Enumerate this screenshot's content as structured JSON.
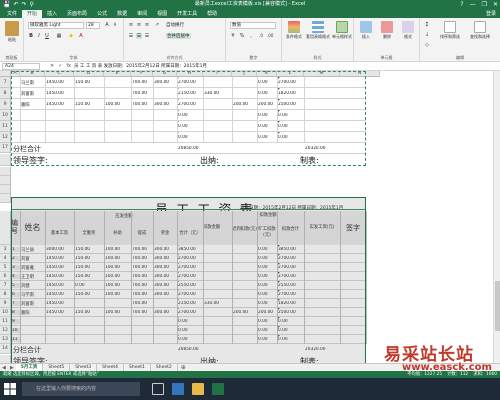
{
  "titlebar": {
    "title": "最新员工excel工资表模板.xls [兼容模式] - Excel",
    "quick_access": [
      "💾",
      "↶",
      "↷",
      "⚲"
    ],
    "window_controls": [
      "?",
      "—",
      "❐",
      "✕"
    ]
  },
  "tabs": [
    "文件",
    "开始",
    "插入",
    "页面布局",
    "公式",
    "数据",
    "审阅",
    "视图",
    "开发工具",
    "帮助"
  ],
  "active_tab": 1,
  "login": "登录",
  "ribbon": {
    "paste": "粘贴",
    "clipboard": "剪贴板",
    "font_name": "微软雅黑 Light",
    "font_size": "28",
    "font_group": "字体",
    "wrap_text": "自动换行",
    "merge_center": "合并后居中",
    "alignment_group": "对齐方式",
    "number_format": "数值",
    "number_group": "数字",
    "conditional_format": "条件格式",
    "table_format": "套用表格格式",
    "cell_styles": "单元格样式",
    "styles_group": "样式",
    "insert": "插入",
    "delete": "删除",
    "format": "格式",
    "cells_group": "单元格",
    "sort_filter": "排序和筛选",
    "find_select": "查找和选择",
    "editing_group": "编辑"
  },
  "formula_bar": {
    "name_box": "A24",
    "formula": "员 工 工 资 表    发放日期：2015年2月12日   所属日期：2015年1月"
  },
  "columns": [
    "A",
    "B",
    "C",
    "D",
    "E",
    "F",
    "G",
    "H",
    "I",
    "J",
    "K",
    "L",
    "M",
    "N"
  ],
  "top_rows": [
    {
      "row": "7",
      "cells": [
        "马兰南",
        "1450.00",
        "150.00",
        "",
        "700.00",
        "300.00",
        "2700.00",
        "",
        "",
        "0.00",
        "2700.00"
      ]
    },
    {
      "row": "8",
      "cells": [
        "刘富南",
        "1450.00",
        "",
        "",
        "700.00",
        "",
        "2150.00",
        "330.00",
        "",
        "0.00",
        "1820.00"
      ]
    },
    {
      "row": "9",
      "cells": [
        "葛阳",
        "1450.00",
        "150.00",
        "100.00",
        "700.00",
        "300.00",
        "2700.00",
        "",
        "200.00",
        "200.00",
        "2500.00"
      ]
    },
    {
      "row": "10",
      "cells": [
        "",
        "",
        "",
        "",
        "",
        "",
        "0.00",
        "",
        "",
        "0.00",
        "0.00"
      ]
    },
    {
      "row": "11",
      "cells": [
        "",
        "",
        "",
        "",
        "",
        "",
        "0.00",
        "",
        "",
        "0.00",
        "0.00"
      ]
    },
    {
      "row": "12",
      "cells": [
        "",
        "",
        "",
        "",
        "",
        "",
        "0.00",
        "",
        "",
        "0.00",
        "0.00"
      ]
    }
  ],
  "top_subtotal": {
    "row": "17",
    "label": "分栏合计",
    "total": "20850.00",
    "net": "20320.00"
  },
  "signatures": {
    "leader": "领导签字:",
    "cashier": "出纳:",
    "preparer": "制表:"
  },
  "lower": {
    "title": "员 工 工 资 表",
    "date_note": "发放日期：2015年2月12日   所属日期：2015年1月",
    "headers": {
      "no": "编号",
      "name": "姓名",
      "due": "应发金额",
      "base": "基本工资",
      "attendance": "全勤奖",
      "subsidy": "补助",
      "commission": "提成",
      "bonus": "奖金",
      "total": "合计（元）",
      "deduct": "扣款金额",
      "penalty": "迟到扣款(元)",
      "absence": "旷工扣款(元)",
      "deduct_total": "扣款合计",
      "net": "实发工资(元)",
      "sign": "签字"
    },
    "rows": [
      {
        "row": "3",
        "no": "1",
        "cells": [
          "马兰丽",
          "3000.00",
          "150.00",
          "100.00",
          "700.00",
          "300.00",
          "3850.00",
          "",
          "",
          "0.00",
          "3850.00"
        ]
      },
      {
        "row": "4",
        "no": "2",
        "cells": [
          "刘富",
          "1450.00",
          "150.00",
          "100.00",
          "700.00",
          "300.00",
          "2700.00",
          "",
          "",
          "0.00",
          "2700.00"
        ]
      },
      {
        "row": "5",
        "no": "3",
        "cells": [
          "刘富雅",
          "1450.00",
          "150.00",
          "100.00",
          "700.00",
          "300.00",
          "2700.00",
          "",
          "",
          "0.00",
          "2700.00"
        ]
      },
      {
        "row": "6",
        "no": "4",
        "cells": [
          "王卫明",
          "1450.00",
          "150.00",
          "100.00",
          "700.00",
          "300.00",
          "2700.00",
          "",
          "",
          "0.00",
          "2700.00"
        ]
      },
      {
        "row": "7",
        "no": "5",
        "cells": [
          "刘健",
          "1450.00",
          "0.00",
          "100.00",
          "700.00",
          "300.00",
          "2550.00",
          "",
          "",
          "0.00",
          "2550.00"
        ]
      },
      {
        "row": "8",
        "no": "6",
        "cells": [
          "马学南",
          "1450.00",
          "150.00",
          "100.00",
          "700.00",
          "300.00",
          "2700.00",
          "",
          "",
          "0.00",
          "2700.00"
        ]
      },
      {
        "row": "9",
        "no": "7",
        "cells": [
          "刘富南",
          "1450.00",
          "",
          "",
          "700.00",
          "",
          "2150.00",
          "330.00",
          "",
          "0.00",
          "1820.00"
        ]
      },
      {
        "row": "10",
        "no": "8",
        "cells": [
          "葛阳",
          "1450.00",
          "150.00",
          "100.00",
          "700.00",
          "300.00",
          "2700.00",
          "",
          "200.00",
          "200.00",
          "2500.00"
        ]
      },
      {
        "row": "11",
        "no": "9",
        "cells": [
          "",
          "",
          "",
          "",
          "",
          "",
          "0.00",
          "",
          "",
          "0.00",
          "0.00"
        ]
      },
      {
        "row": "12",
        "no": "10",
        "cells": [
          "",
          "",
          "",
          "",
          "",
          "",
          "0.00",
          "",
          "",
          "0.00",
          "0.00"
        ]
      },
      {
        "row": "13",
        "no": "11",
        "cells": [
          "",
          "",
          "",
          "",
          "",
          "",
          "0.00",
          "",
          "",
          "0.00",
          "0.00"
        ]
      }
    ],
    "subtotal": {
      "row": "14",
      "label": "分栏合计",
      "total": "20850.00",
      "net": "20320.00"
    }
  },
  "sheet_tabs": [
    "5月工资",
    "Sheet5",
    "Sheet3",
    "Sheet4",
    "Sheet1",
    "Sheet2"
  ],
  "active_sheet": 0,
  "status": {
    "left": "就绪 选定目标区域，然后按 ENTER 或选择“粘贴”",
    "average": "平均值：1227.25",
    "count": "计数：112",
    "sum": "求和：1060"
  },
  "taskbar": {
    "search_placeholder": "在这里输入你要搜索的内容"
  },
  "watermark": {
    "line1": "易采站长站",
    "line2": "www.easck.com"
  },
  "colors": {
    "excel_green": "#217346",
    "watermark_red": "#c0392b"
  }
}
